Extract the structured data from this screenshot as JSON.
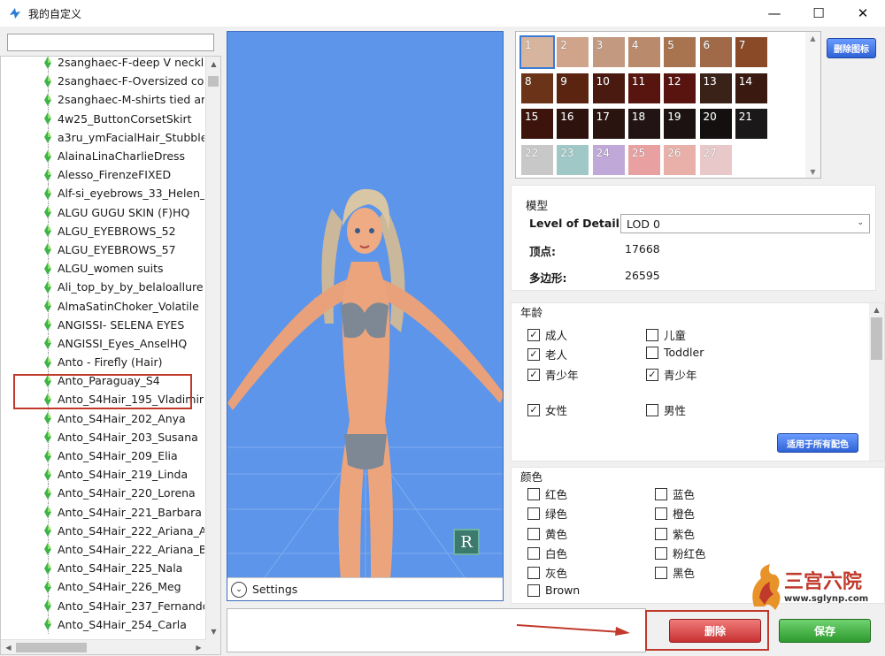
{
  "window": {
    "title": "我的自定义",
    "controls": {
      "minimize": "—",
      "maximize": "☐",
      "close": "✕"
    }
  },
  "sidebar": {
    "search_value": "",
    "items": [
      "2sanghaec-F-deep V neckli",
      "2sanghaec-F-Oversized col",
      "2sanghaec-M-shirts tied arc",
      "4w25_ButtonCorsetSkirt",
      "a3ru_ymFacialHair_Stubble",
      "AlainaLinaCharlieDress",
      "Alesso_FirenzeFIXED",
      "Alf-si_eyebrows_33_Helen_l",
      "ALGU GUGU SKIN (F)HQ",
      "ALGU_EYEBROWS_52",
      "ALGU_EYEBROWS_57",
      "ALGU_women suits",
      "Ali_top_by_by_belaloallure",
      "AlmaSatinChoker_Volatile",
      "ANGISSI- SELENA EYES",
      "ANGISSI_Eyes_AnselHQ",
      "Anto - Firefly (Hair)",
      "Anto_Paraguay_S4",
      "Anto_S4Hair_195_Vladimir",
      "Anto_S4Hair_202_Anya",
      "Anto_S4Hair_203_Susana",
      "Anto_S4Hair_209_Elia",
      "Anto_S4Hair_219_Linda",
      "Anto_S4Hair_220_Lorena",
      "Anto_S4Hair_221_Barbara",
      "Anto_S4Hair_222_Ariana_A",
      "Anto_S4Hair_222_Ariana_B",
      "Anto_S4Hair_225_Nala",
      "Anto_S4Hair_226_Meg",
      "Anto_S4Hair_237_Fernando",
      "Anto_S4Hair_254_Carla"
    ],
    "selected_index": 19
  },
  "preview": {
    "settings_label": "Settings",
    "cube_letter": "R"
  },
  "swatches": {
    "delete_icon_label": "删除图标",
    "items": [
      {
        "n": "1",
        "c": "#d7b49e"
      },
      {
        "n": "2",
        "c": "#cfa48a"
      },
      {
        "n": "3",
        "c": "#c39a80"
      },
      {
        "n": "4",
        "c": "#b98a6c"
      },
      {
        "n": "5",
        "c": "#a8744f"
      },
      {
        "n": "6",
        "c": "#a06a48"
      },
      {
        "n": "7",
        "c": "#8a4a28"
      },
      {
        "n": "8",
        "c": "#6b3418"
      },
      {
        "n": "9",
        "c": "#5a2410"
      },
      {
        "n": "10",
        "c": "#4a1a10"
      },
      {
        "n": "11",
        "c": "#58140e"
      },
      {
        "n": "12",
        "c": "#5a1410"
      },
      {
        "n": "13",
        "c": "#3a2218"
      },
      {
        "n": "14",
        "c": "#3a1a10"
      },
      {
        "n": "15",
        "c": "#3c140c"
      },
      {
        "n": "16",
        "c": "#2e120e"
      },
      {
        "n": "17",
        "c": "#2a1410"
      },
      {
        "n": "18",
        "c": "#221414"
      },
      {
        "n": "19",
        "c": "#1c1212"
      },
      {
        "n": "20",
        "c": "#141010"
      },
      {
        "n": "21",
        "c": "#1a1818"
      },
      {
        "n": "22",
        "c": "#c8c8c8"
      },
      {
        "n": "23",
        "c": "#9fc8c6"
      },
      {
        "n": "24",
        "c": "#c0a8d8"
      },
      {
        "n": "25",
        "c": "#e8a0a0"
      },
      {
        "n": "26",
        "c": "#e8b0a8"
      },
      {
        "n": "27",
        "c": "#e8c8c8"
      }
    ]
  },
  "model": {
    "group_title": "模型",
    "lod_label": "Level of Detail:",
    "lod_value": "LOD 0",
    "vertices_label": "顶点:",
    "vertices_value": "17668",
    "polygons_label": "多边形:",
    "polygons_value": "26595"
  },
  "age": {
    "group_title": "年龄",
    "apply_label": "适用于所有配色",
    "options": [
      {
        "label": "成人",
        "checked": true
      },
      {
        "label": "儿童",
        "checked": false
      },
      {
        "label": "老人",
        "checked": true
      },
      {
        "label": "Toddler",
        "checked": false
      },
      {
        "label": "青少年",
        "checked": true
      },
      {
        "label": "青少年",
        "checked": true
      },
      {
        "label": "女性",
        "checked": true
      },
      {
        "label": "男性",
        "checked": false
      }
    ]
  },
  "colors": {
    "group_title": "颜色",
    "options": [
      {
        "label": "红色",
        "checked": false
      },
      {
        "label": "蓝色",
        "checked": false
      },
      {
        "label": "绿色",
        "checked": false
      },
      {
        "label": "橙色",
        "checked": false
      },
      {
        "label": "黄色",
        "checked": false
      },
      {
        "label": "紫色",
        "checked": false
      },
      {
        "label": "白色",
        "checked": false
      },
      {
        "label": "粉红色",
        "checked": false
      },
      {
        "label": "灰色",
        "checked": false
      },
      {
        "label": "黑色",
        "checked": false
      },
      {
        "label": "Brown",
        "checked": false
      }
    ]
  },
  "footer": {
    "delete_label": "删除",
    "save_label": "保存"
  },
  "watermark": {
    "title": "三宫六院",
    "url": "www.sglynp.com"
  },
  "accent_colors": {
    "highlight_red": "#c0392b",
    "preview_blue": "#5c95ea",
    "button_blue": "#2f62d6",
    "delete_red": "#c83232",
    "save_green": "#2e9a2e"
  }
}
